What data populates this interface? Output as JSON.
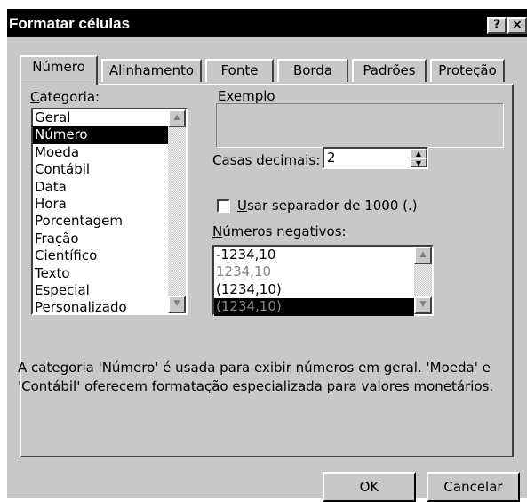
{
  "window": {
    "title": "Formatar células",
    "help_glyph": "?",
    "close_glyph": "×"
  },
  "tabs": [
    {
      "label": "Número",
      "active": true
    },
    {
      "label": "Alinhamento"
    },
    {
      "label": "Fonte"
    },
    {
      "label": "Borda"
    },
    {
      "label": "Padrões"
    },
    {
      "label": "Proteção"
    }
  ],
  "category": {
    "label_accel": "C",
    "label_rest": "ategoria:",
    "items": [
      "Geral",
      "Número",
      "Moeda",
      "Contábil",
      "Data",
      "Hora",
      "Porcentagem",
      "Fração",
      "Científico",
      "Texto",
      "Especial",
      "Personalizado"
    ],
    "selected": "Número"
  },
  "example": {
    "label": "Exemplo",
    "value": ""
  },
  "decimal_places": {
    "label_pre": "Casas ",
    "label_accel": "d",
    "label_post": "ecimais:",
    "value": "2"
  },
  "separator_checkbox": {
    "label_accel": "U",
    "label_rest": "sar separador de 1000 (.)",
    "checked": false
  },
  "negative_numbers": {
    "label_accel": "N",
    "label_rest": "úmeros negativos:",
    "items": [
      {
        "text": "-1234,10",
        "color": "#000000"
      },
      {
        "text": "1234,10",
        "color": "#808080"
      },
      {
        "text": "(1234,10)",
        "color": "#000000"
      },
      {
        "text": "(1234,10)",
        "color": "#808080",
        "selected": true
      }
    ]
  },
  "description": "A categoria 'Número' é usada para exibir números em geral. 'Moeda' e 'Contábil' oferecem formatação especializada para valores monetários.",
  "buttons": {
    "ok": "OK",
    "cancel": "Cancelar"
  },
  "colors": {
    "face": "#c8c8c8",
    "titlebar": "#000000",
    "selection": "#000000"
  }
}
